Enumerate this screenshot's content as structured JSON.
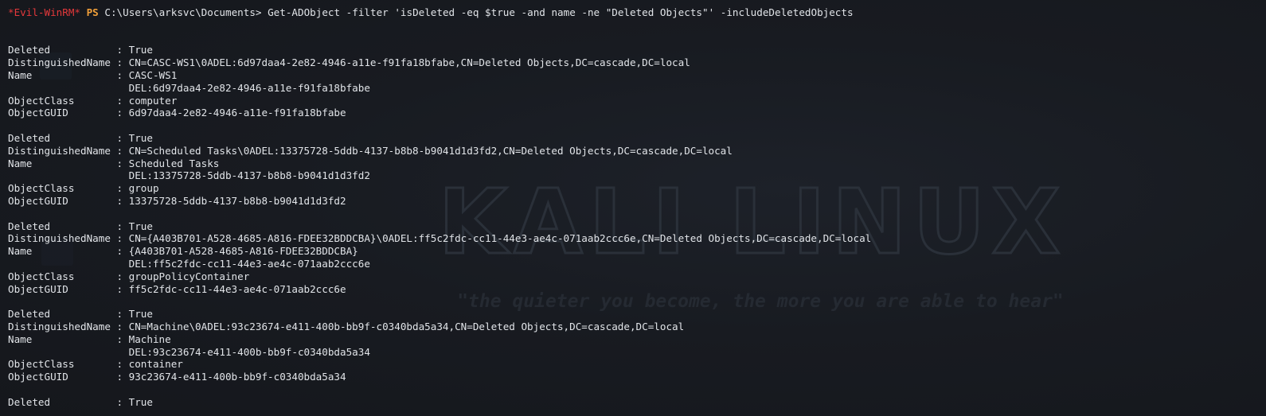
{
  "watermark": {
    "title": "KALI LINUX",
    "tagline": "\"the quieter you become, the more you are able to hear\""
  },
  "prompt": {
    "shell": "*Evil-WinRM*",
    "ps": "PS",
    "path": "C:\\Users\\arksvc\\Documents>",
    "command": "Get-ADObject -filter 'isDeleted -eq $true -and name -ne \"Deleted Objects\"' -includeDeletedObjects"
  },
  "output_lines": [
    "",
    "",
    "Deleted           : True",
    "DistinguishedName : CN=CASC-WS1\\0ADEL:6d97daa4-2e82-4946-a11e-f91fa18bfabe,CN=Deleted Objects,DC=cascade,DC=local",
    "Name              : CASC-WS1",
    "                    DEL:6d97daa4-2e82-4946-a11e-f91fa18bfabe",
    "ObjectClass       : computer",
    "ObjectGUID        : 6d97daa4-2e82-4946-a11e-f91fa18bfabe",
    "",
    "Deleted           : True",
    "DistinguishedName : CN=Scheduled Tasks\\0ADEL:13375728-5ddb-4137-b8b8-b9041d1d3fd2,CN=Deleted Objects,DC=cascade,DC=local",
    "Name              : Scheduled Tasks",
    "                    DEL:13375728-5ddb-4137-b8b8-b9041d1d3fd2",
    "ObjectClass       : group",
    "ObjectGUID        : 13375728-5ddb-4137-b8b8-b9041d1d3fd2",
    "",
    "Deleted           : True",
    "DistinguishedName : CN={A403B701-A528-4685-A816-FDEE32BDDCBA}\\0ADEL:ff5c2fdc-cc11-44e3-ae4c-071aab2ccc6e,CN=Deleted Objects,DC=cascade,DC=local",
    "Name              : {A403B701-A528-4685-A816-FDEE32BDDCBA}",
    "                    DEL:ff5c2fdc-cc11-44e3-ae4c-071aab2ccc6e",
    "ObjectClass       : groupPolicyContainer",
    "ObjectGUID        : ff5c2fdc-cc11-44e3-ae4c-071aab2ccc6e",
    "",
    "Deleted           : True",
    "DistinguishedName : CN=Machine\\0ADEL:93c23674-e411-400b-bb9f-c0340bda5a34,CN=Deleted Objects,DC=cascade,DC=local",
    "Name              : Machine",
    "                    DEL:93c23674-e411-400b-bb9f-c0340bda5a34",
    "ObjectClass       : container",
    "ObjectGUID        : 93c23674-e411-400b-bb9f-c0340bda5a34",
    "",
    "Deleted           : True"
  ]
}
